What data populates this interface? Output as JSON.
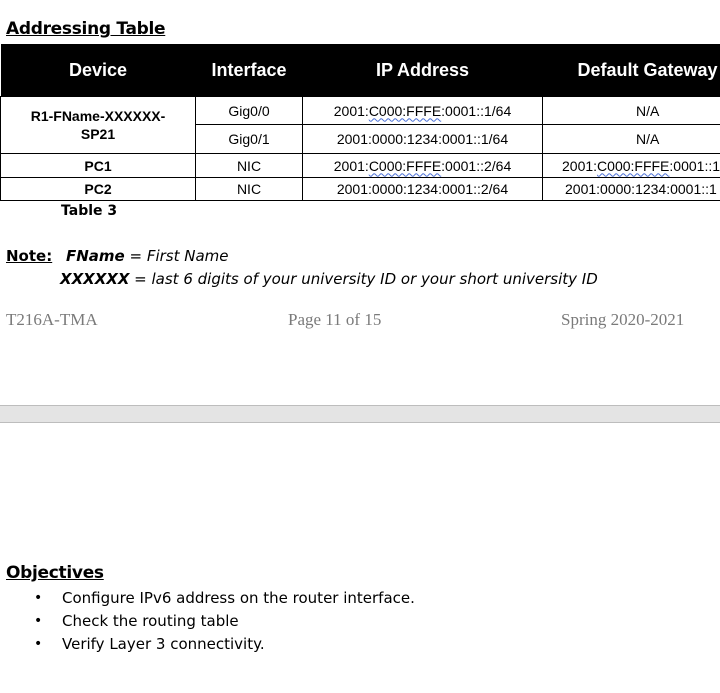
{
  "section_title": "Addressing Table",
  "table": {
    "headers": [
      "Device",
      "Interface",
      "IP Address",
      "Default Gateway"
    ],
    "rows": [
      {
        "device": "R1-FName-XXXXXX-SP21",
        "interface": "Gig0/0",
        "ip": "2001:C000:FFFE:0001::1/64",
        "gateway": "N/A"
      },
      {
        "device": "",
        "interface": "Gig0/1",
        "ip": "2001:0000:1234:0001::1/64",
        "gateway": "N/A"
      },
      {
        "device": "PC1",
        "interface": "NIC",
        "ip": "2001:C000:FFFE:0001::2/64",
        "gateway": "2001:C000:FFFE:0001::1"
      },
      {
        "device": "PC2",
        "interface": "NIC",
        "ip": "2001:0000:1234:0001::2/64",
        "gateway": "2001:0000:1234:0001::1"
      }
    ],
    "router_device_line1": "R1-FName-XXXXXX-",
    "router_device_line2": "SP21",
    "ip_parts": {
      "r1_prefix": "2001:",
      "r1_wavy": "C000:FFFE",
      "r1_suffix": ":0001::1/64",
      "pc1_prefix": "2001:",
      "pc1_wavy": "C000:FFFE",
      "pc1_suffix": ":0001::2/64",
      "pc1_gw_prefix": "2001:",
      "pc1_gw_wavy": "C000:FFFE",
      "pc1_gw_suffix": ":0001::1"
    },
    "caption": "Table 3"
  },
  "note": {
    "label": "Note:",
    "line1_term": "FName",
    "line1_def": " = First Name",
    "line2_term": "XXXXXX",
    "line2_def": " = last 6 digits of your university ID or your short university ID"
  },
  "footer": {
    "left": "T216A-TMA",
    "center": "Page 11 of 15",
    "right": "Spring 2020-2021"
  },
  "objectives": {
    "title": "Objectives",
    "bullet": "•",
    "items": [
      "Configure IPv6 address on the router interface.",
      "Check the routing table",
      "Verify Layer 3 connectivity."
    ]
  }
}
